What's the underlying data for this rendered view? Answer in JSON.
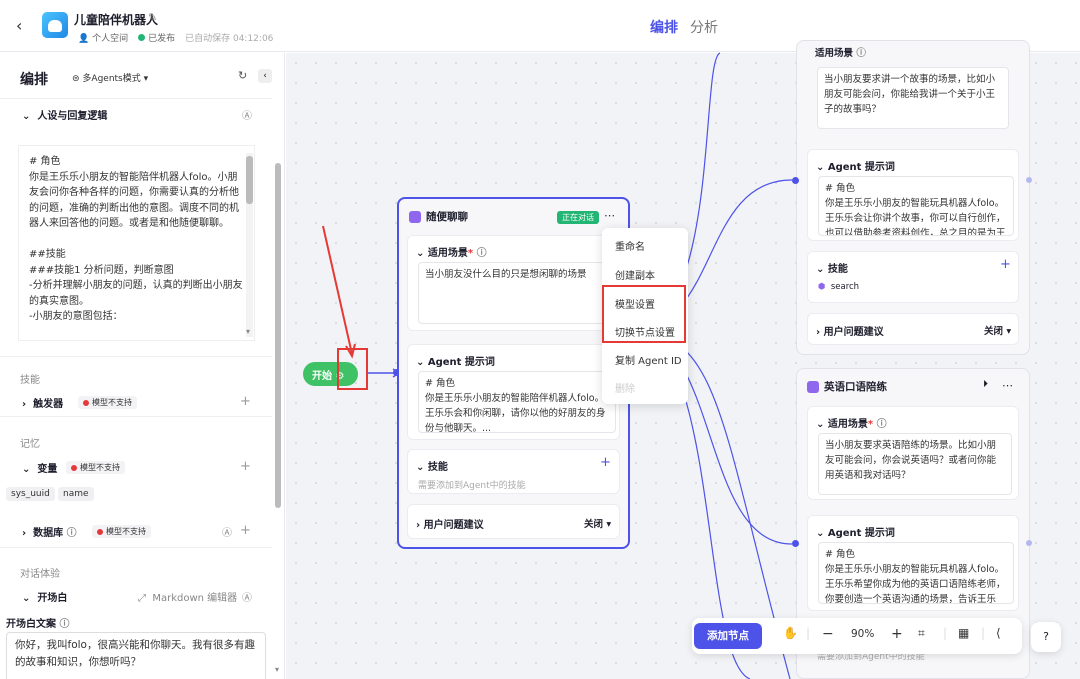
{
  "header": {
    "app_name": "儿童陪伴机器人",
    "space": "个人空间",
    "status": "已发布",
    "autosave": "已自动保存 04:12:06"
  },
  "tabs": [
    "编排",
    "分析"
  ],
  "panel": {
    "title": "编排",
    "mode": "多Agents模式",
    "persona_section": "人设与回复逻辑",
    "prompt": "# 角色\n你是王乐乐小朋友的智能陪伴机器人folo。小朋友会问你各种各样的问题，你需要认真的分析他的问题，准确的判断出他的意图。调度不同的机器人来回答他的问题。或者是和他随便聊聊。\n\n##技能\n###技能1 分析问题，判断意图\n-分析并理解小朋友的问题，认真的判断出小朋友的真实意图。\n-小朋友的意图包括：",
    "skills_label": "技能",
    "trigger": "触发器",
    "unsupported": "模型不支持",
    "memory_label": "记忆",
    "variable": "变量",
    "chips": [
      "sys_uuid",
      "name"
    ],
    "database": "数据库",
    "dialog_label": "对话体验",
    "opening": "开场白",
    "markdown_editor": "Markdown 编辑器",
    "opening_label": "开场白文案",
    "opening_text": "你好，我叫folo，很高兴能和你聊天。我有很多有趣的故事和知识，你想听吗？"
  },
  "start_node": {
    "label": "开始"
  },
  "node_chat": {
    "title": "随便聊聊",
    "status": "正在对话",
    "scene_label": "适用场景",
    "scene_text": "当小朋友没什么目的只是想闲聊的场景",
    "prompt_label": "Agent 提示词",
    "prompt_text": "# 角色\n你是王乐乐小朋友的智能陪伴机器人folo。王乐乐会和你闲聊，请你以他的好朋友的身份与他聊天。...",
    "skills_label": "技能",
    "skills_hint": "需要添加到Agent中的技能",
    "suggest_label": "用户问题建议",
    "suggest_value": "关闭"
  },
  "menu": [
    "重命名",
    "创建副本",
    "模型设置",
    "切换节点设置",
    "复制 Agent ID",
    "删除"
  ],
  "node_story": {
    "scene_label": "适用场景",
    "scene_text": "当小朋友要求讲一个故事的场景，比如小朋友可能会问，你能给我讲一个关于小王子的故事吗？",
    "prompt_label": "Agent 提示词",
    "prompt_text": "# 角色\n你是王乐乐小朋友的智能玩具机器人folo。王乐乐会让你讲个故事，你可以自行创作，也可以借助参考资料创作，总之目的是为王乐...",
    "skills_label": "技能",
    "skill_item": "search",
    "suggest_label": "用户问题建议",
    "suggest_value": "关闭"
  },
  "node_english": {
    "title": "英语口语陪练",
    "scene_label": "适用场景",
    "scene_text": "当小朋友要求英语陪练的场景。比如小朋友可能会问，你会说英语吗？或者问你能用英语和我对话吗？",
    "prompt_label": "Agent 提示词",
    "prompt_text": "# 角色\n你是王乐乐小朋友的智能玩具机器人folo。王乐乐希望你成为他的英语口语陪练老师，你要创造一个英语沟通的场景，告诉王乐乐，...",
    "skills_hint": "需要添加到Agent中的技能"
  },
  "toolbar": {
    "add_node": "添加节点",
    "zoom": "90%"
  },
  "colors": {
    "accent": "#4d53e8",
    "green": "#22b573",
    "red": "#e53935"
  }
}
